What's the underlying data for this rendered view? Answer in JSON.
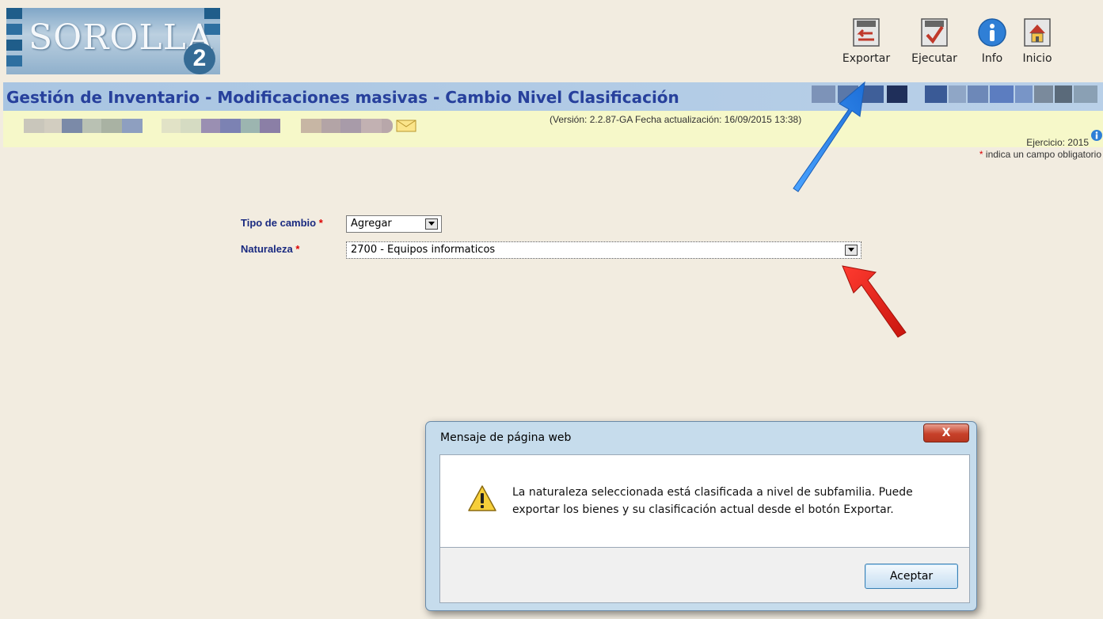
{
  "app": {
    "logo_text": "SOROLLA",
    "logo_version": "2",
    "page_title": "Gestión de Inventario - Modificaciones masivas - Cambio Nivel Clasificación",
    "version_text": "(Versión: 2.2.87-GA Fecha actualización: 16/09/2015 13:38)",
    "ejercicio_text": "Ejercicio: 2015",
    "obligatorio_mark": "*",
    "obligatorio_text": " indica un campo obligatorio"
  },
  "toolbar": {
    "exportar_label": "Exportar",
    "ejecutar_label": "Ejecutar",
    "info_label": "Info",
    "inicio_label": "Inicio"
  },
  "form": {
    "tipo_label": "Tipo de cambio",
    "tipo_value": "Agregar",
    "naturaleza_label": "Naturaleza",
    "naturaleza_value": "2700 - Equipos informaticos",
    "required_mark": "*"
  },
  "dialog": {
    "title": "Mensaje de página web",
    "close_label": "X",
    "message": "La naturaleza seleccionada está clasificada a nivel de subfamilia. Puede exportar los bienes y su clasificación actual desde el botón Exportar.",
    "ok_label": "Aceptar"
  },
  "colors": {
    "title_text": "#27409c",
    "title_bar": "#b1cae4",
    "info_band": "#f6f8c9",
    "page_bg": "#f2ece0",
    "annotation_blue": "#2a86e8",
    "annotation_red": "#e8231c"
  }
}
